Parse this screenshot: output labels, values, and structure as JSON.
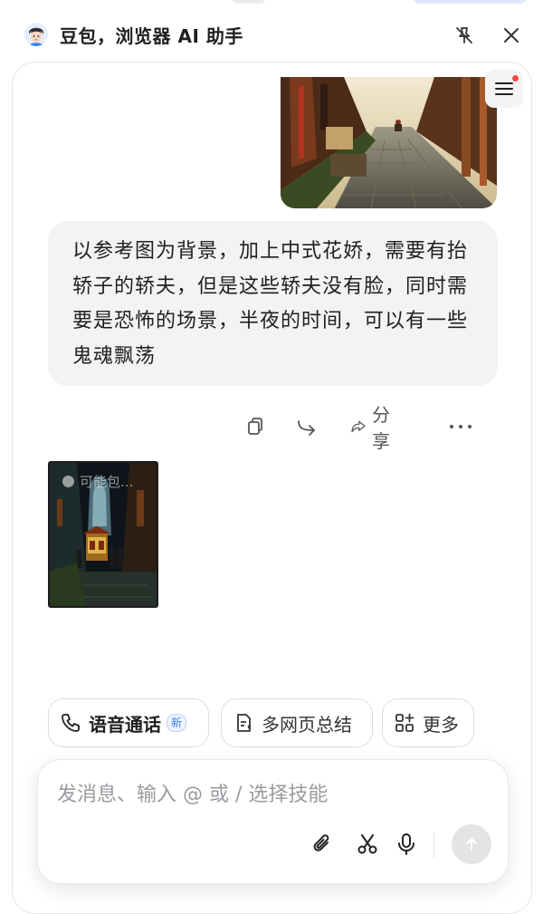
{
  "header": {
    "title": "豆包，浏览器 AI 助手",
    "avatar_icon": "doubao-avatar-icon",
    "pin_icon": "unpin-icon",
    "close_icon": "close-icon"
  },
  "conversation": {
    "menu_icon": "menu-icon",
    "menu_badge_color": "#f0483e",
    "reference_image": "old town street photo",
    "user_message": "以参考图为背景，加上中式花娇，需要有抬轿子的轿夫，但是这些轿夫没有脸，同时需要是恐怖的场景，半夜的时间，可以有一些鬼魂飘荡",
    "actions": {
      "copy_icon": "copy-icon",
      "forward_icon": "forward-icon",
      "share_icon": "share-icon",
      "share_label": "分享",
      "more_icon": "more-icon"
    },
    "generated_image": {
      "badge_text": "可能包..."
    }
  },
  "chips": [
    {
      "label": "语音通话",
      "icon": "phone-icon",
      "badge": "新"
    },
    {
      "label": "多网页总结",
      "icon": "doc-summary-icon"
    },
    {
      "label": "更多",
      "icon": "apps-grid-icon"
    }
  ],
  "composer": {
    "placeholder": "发消息、输入 @ 或 / 选择技能",
    "value": "",
    "tools": [
      "attach-icon",
      "scissors-icon",
      "mic-icon"
    ],
    "send_icon": "send-arrow-icon"
  },
  "colors": {
    "accent": "#3b7cf6",
    "bubble": "#f3f3f4",
    "send_disabled": "#e4e4e6"
  }
}
